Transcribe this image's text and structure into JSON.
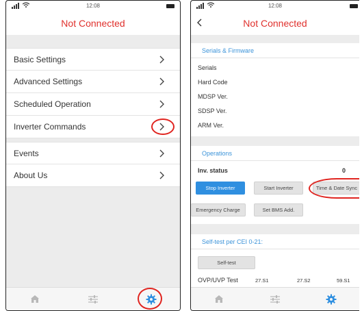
{
  "left_screen": {
    "status": {
      "time": "12:08"
    },
    "title": "Not Connected",
    "menu": [
      {
        "label": "Basic Settings"
      },
      {
        "label": "Advanced Settings"
      },
      {
        "label": "Scheduled Operation"
      },
      {
        "label": "Inverter Commands"
      },
      {
        "label": "Events"
      },
      {
        "label": "About Us"
      }
    ],
    "tabs": [
      "home-icon",
      "sliders-icon",
      "gear-icon"
    ]
  },
  "right_screen": {
    "status": {
      "time": "12:08"
    },
    "title": "Not Connected",
    "serials_section": {
      "heading": "Serials & Firmware",
      "rows": [
        "Serials",
        "Hard Code",
        "MDSP Ver.",
        "SDSP Ver.",
        "ARM Ver."
      ]
    },
    "operations_section": {
      "heading": "Operations",
      "inv_status_label": "Inv. status",
      "inv_status_value": "0",
      "buttons": {
        "stop_inverter": "Stop Inverter",
        "start_inverter": "Start Inverter",
        "time_date_sync": "Time & Date Sync",
        "emergency_charge": "Emergency Charge",
        "set_bms_add": "Set BMS Add."
      }
    },
    "selftest_section": {
      "heading": "Self-test per CEI 0-21:",
      "button": "Self-test",
      "ovp_label": "OVP/UVP Test",
      "col1": "27.S1",
      "col2": "27.S2",
      "col3": "59.S1"
    },
    "tabs": [
      "home-icon",
      "sliders-icon",
      "gear-icon"
    ]
  },
  "colors": {
    "title_red": "#e0302c",
    "section_blue": "#3b93d9",
    "button_blue": "#2f8fe0",
    "annotation_red": "#e0241f"
  }
}
